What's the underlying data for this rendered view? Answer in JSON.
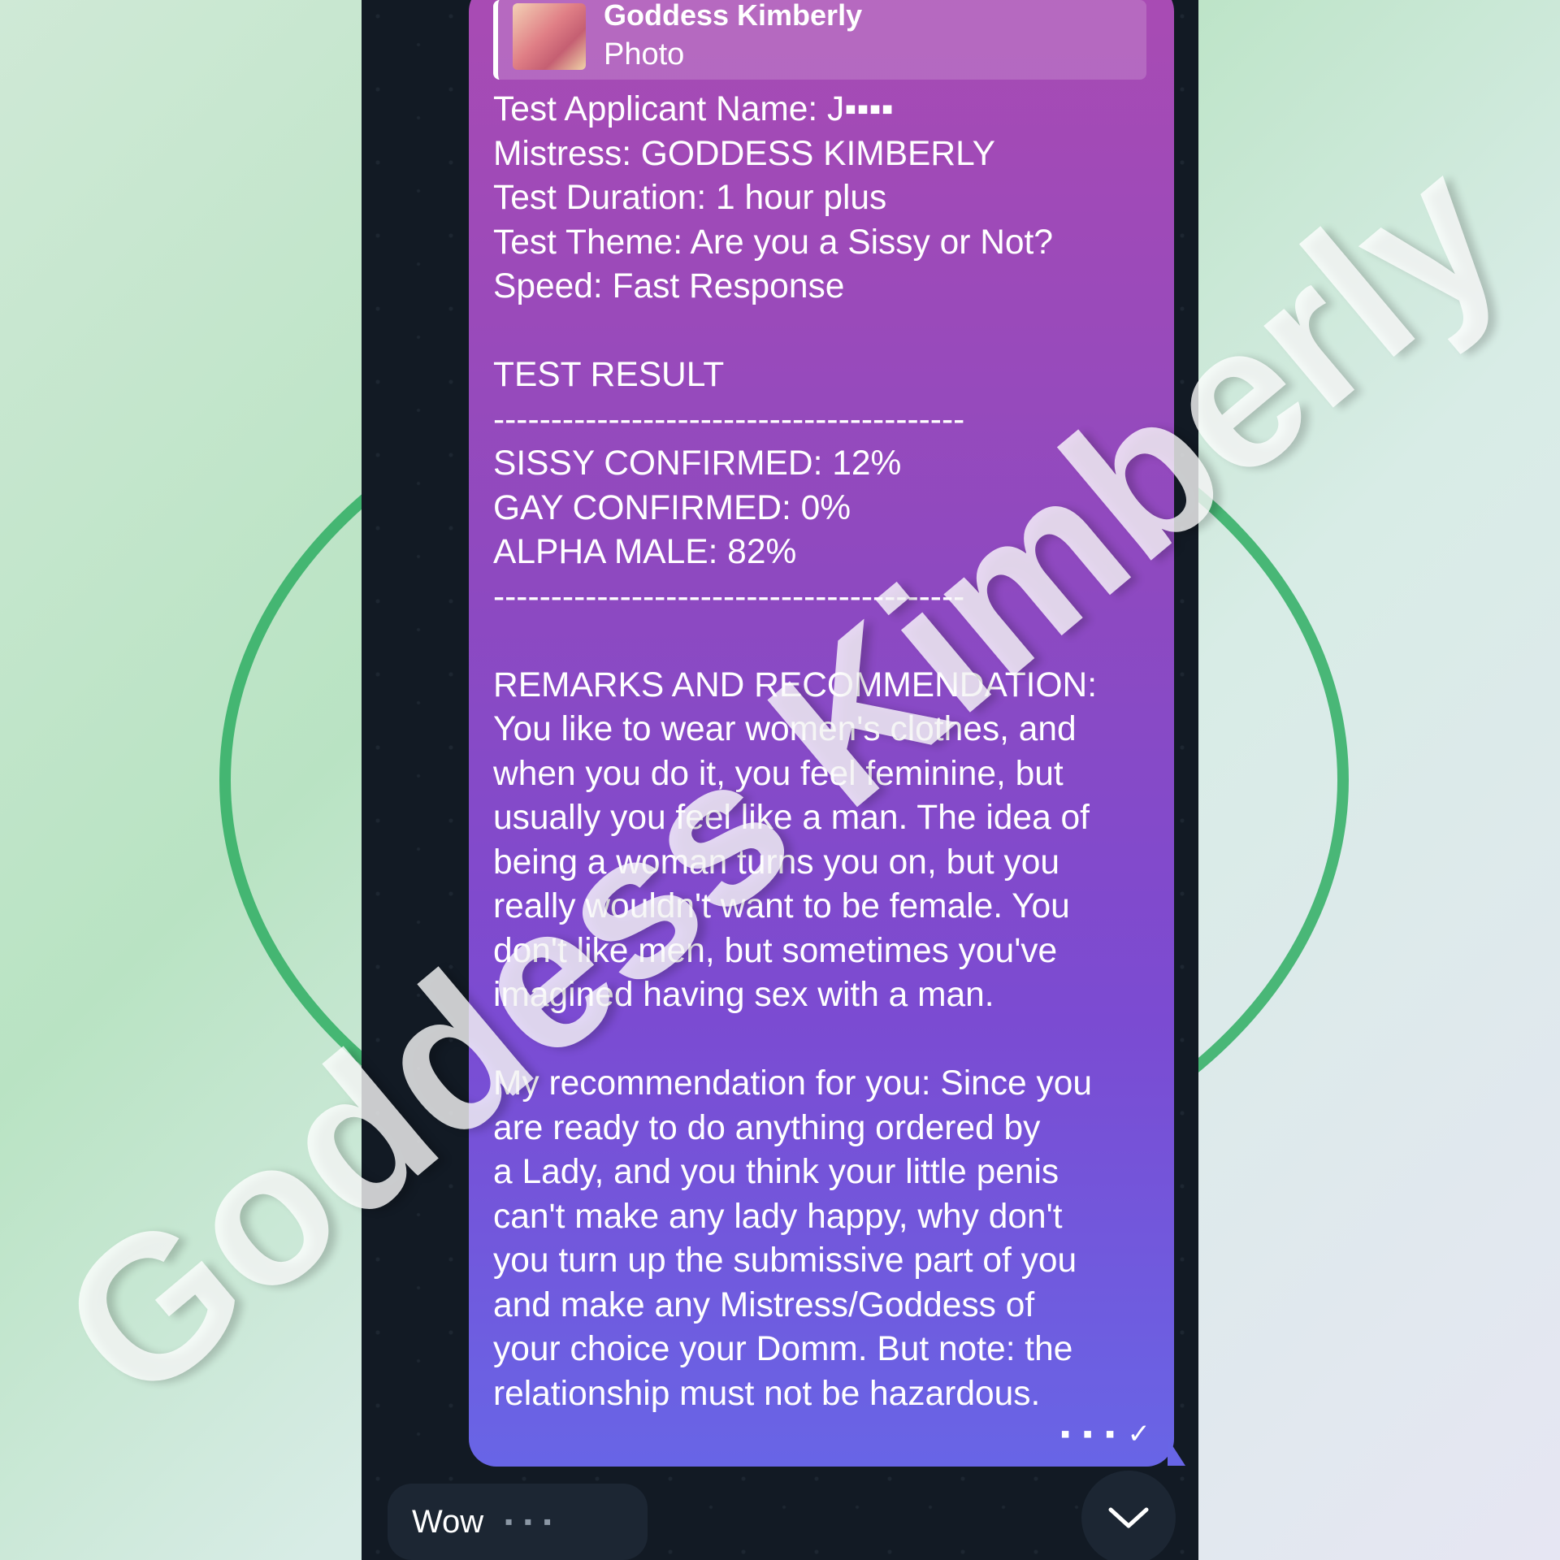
{
  "reply": {
    "sender": "Goddess Kimberly",
    "type": "Photo"
  },
  "message": {
    "info_lines": [
      "Test Applicant Name: J▪▪▪▪",
      "Mistress: GODDESS KIMBERLY",
      "Test Duration: 1 hour plus",
      "Test Theme: Are you a Sissy or Not?",
      "Speed: Fast Response"
    ],
    "result_title": "TEST RESULT",
    "divider": "-----------------------------------------",
    "results": [
      "SISSY CONFIRMED: 12%",
      "GAY CONFIRMED: 0%",
      "ALPHA MALE: 82%"
    ],
    "remarks_title": "REMARKS AND RECOMMENDATION:",
    "remarks_lines": [
      "You like to wear women's clothes, and",
      "when you do it, you feel feminine, but",
      "usually you feel like a man. The idea of",
      "being a woman turns you on, but you",
      "really wouldn't want to be female. You",
      "don't like men, but sometimes you've",
      "imagined having sex with a man."
    ],
    "recommendation_lines": [
      "My recommendation for you: Since you",
      "are ready to do anything ordered by",
      "a Lady, and you think your little penis",
      "can't make any lady happy, why don't",
      "you turn up the submissive part of you",
      "and make any Mistress/Goddess of",
      "your choice your Domm. But note: the",
      "relationship must not be hazardous."
    ],
    "time": "▪ ▪ ▪ ✓"
  },
  "next_message": {
    "text": "Wow",
    "time": "▪ ▪ ▪"
  },
  "scroll_icon": "chevron-down-icon",
  "watermark": "Goddess Kimberly"
}
